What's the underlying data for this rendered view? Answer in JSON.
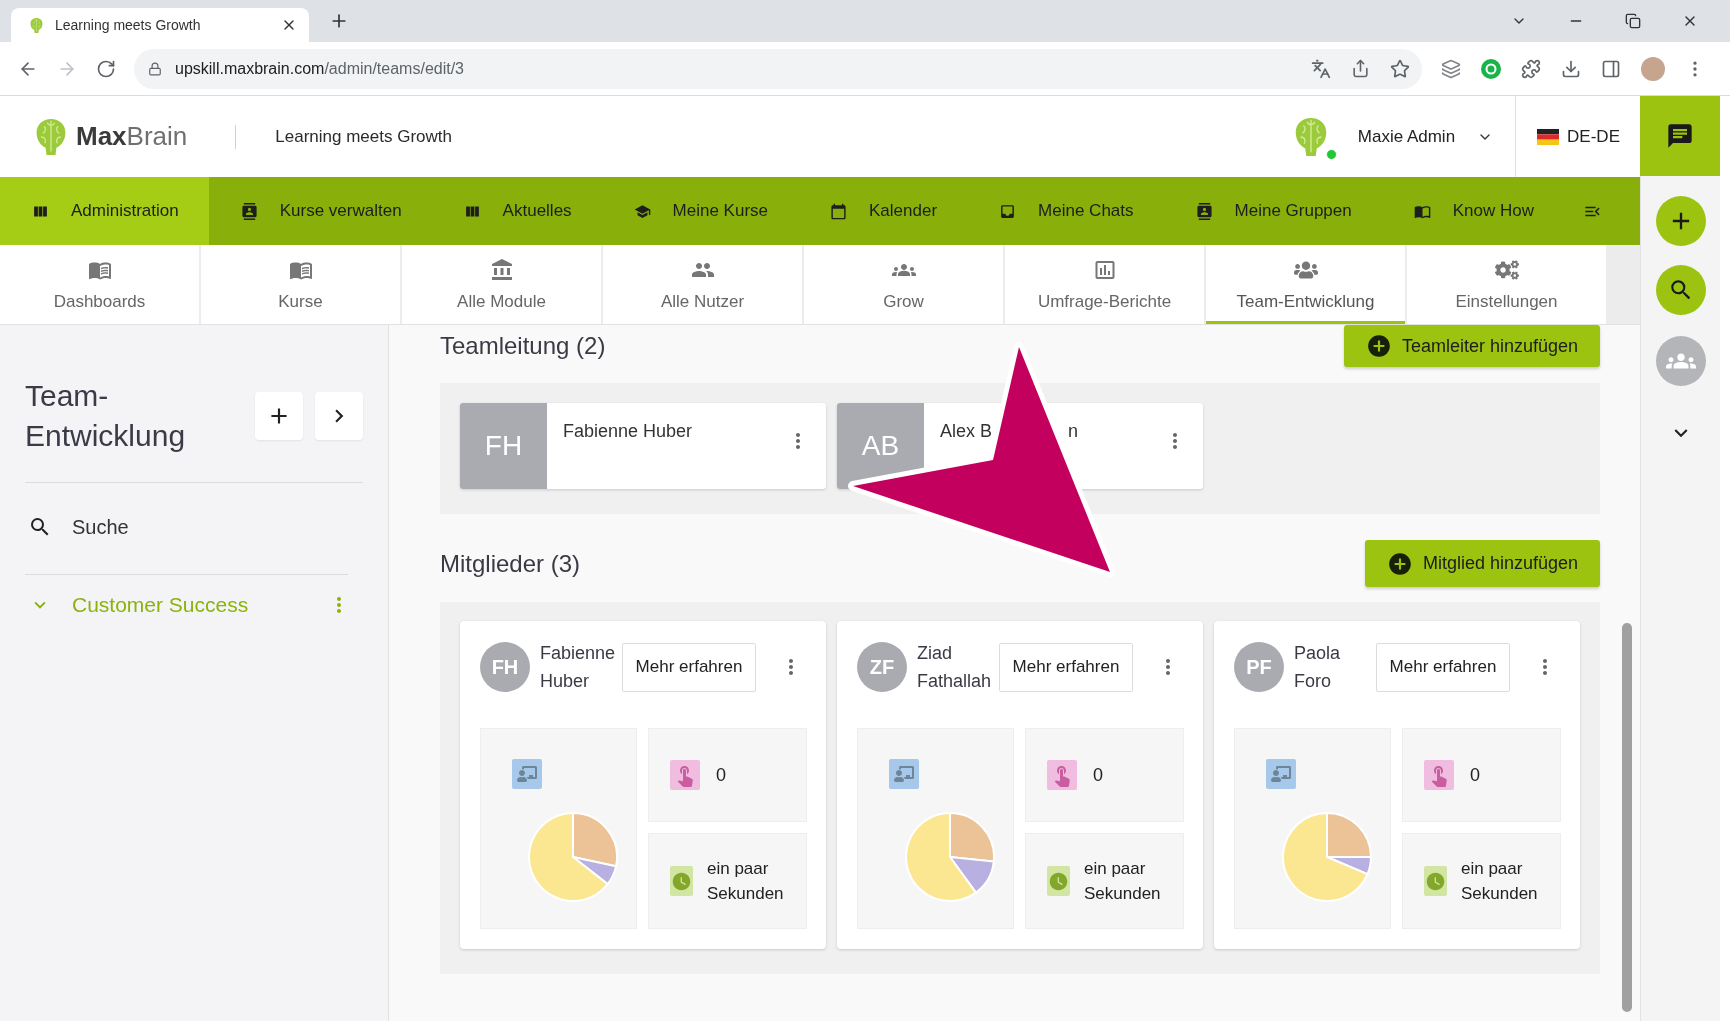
{
  "browser": {
    "tabs": [
      {
        "title": "Learning meets Growth",
        "selected": true
      }
    ],
    "forward_disabled": true,
    "url": {
      "host": "upskill.maxbrain.com",
      "path": "/admin/teams/edit/3"
    }
  },
  "header": {
    "logo": "**Max**Brain",
    "tagline": "Learning meets Growth",
    "user": {
      "name": "Maxie Admin",
      "online": true
    },
    "language": "DE-DE"
  },
  "main_nav": [
    {
      "label": "Administration",
      "selected": true
    },
    {
      "label": "Kurse verwalten",
      "selected": false
    },
    {
      "label": "Aktuelles",
      "selected": false
    },
    {
      "label": "Meine Kurse",
      "selected": false
    },
    {
      "label": "Kalender",
      "selected": false
    },
    {
      "label": "Meine Chats",
      "selected": false
    },
    {
      "label": "Meine Gruppen",
      "selected": false
    },
    {
      "label": "Know How",
      "selected": false
    }
  ],
  "section_tabs": [
    {
      "label": "Dashboards",
      "selected": false
    },
    {
      "label": "Kurse",
      "selected": false
    },
    {
      "label": "Alle Module",
      "selected": false
    },
    {
      "label": "Alle Nutzer",
      "selected": false
    },
    {
      "label": "Grow",
      "selected": false
    },
    {
      "label": "Umfrage-Berichte",
      "selected": false
    },
    {
      "label": "Team-Entwicklung",
      "selected": true
    },
    {
      "label": "Einstellungen",
      "selected": false
    }
  ],
  "sidebar": {
    "title": "Team-Entwicklung",
    "search_label": "Suche",
    "items": [
      {
        "label": "Customer Success",
        "selected": true,
        "expanded": true
      }
    ]
  },
  "team_leads": {
    "heading": "Teamleitung (2)",
    "add_button": "Teamleiter hinzufügen",
    "cards": [
      {
        "initials": "FH",
        "name_parts": [
          "Fabienne Huber"
        ]
      },
      {
        "initials": "AB",
        "name_parts": [
          "Alex B",
          "n"
        ]
      }
    ]
  },
  "members": {
    "heading": "Mitglieder (3)",
    "add_button": "Mitglied hinzufügen",
    "cards": [
      {
        "initials": "FH",
        "name": "Fabienne Huber",
        "action": "Mehr erfahren",
        "count": "0",
        "last_active": "ein paar Sekunden"
      },
      {
        "initials": "ZF",
        "name": "Ziad Fathallah",
        "action": "Mehr erfahren",
        "count": "0",
        "last_active": "ein paar Sekunden"
      },
      {
        "initials": "PF",
        "name": "Paola Foro",
        "action": "Mehr erfahren",
        "count": "0",
        "last_active": "ein paar Sekunden"
      }
    ]
  }
}
